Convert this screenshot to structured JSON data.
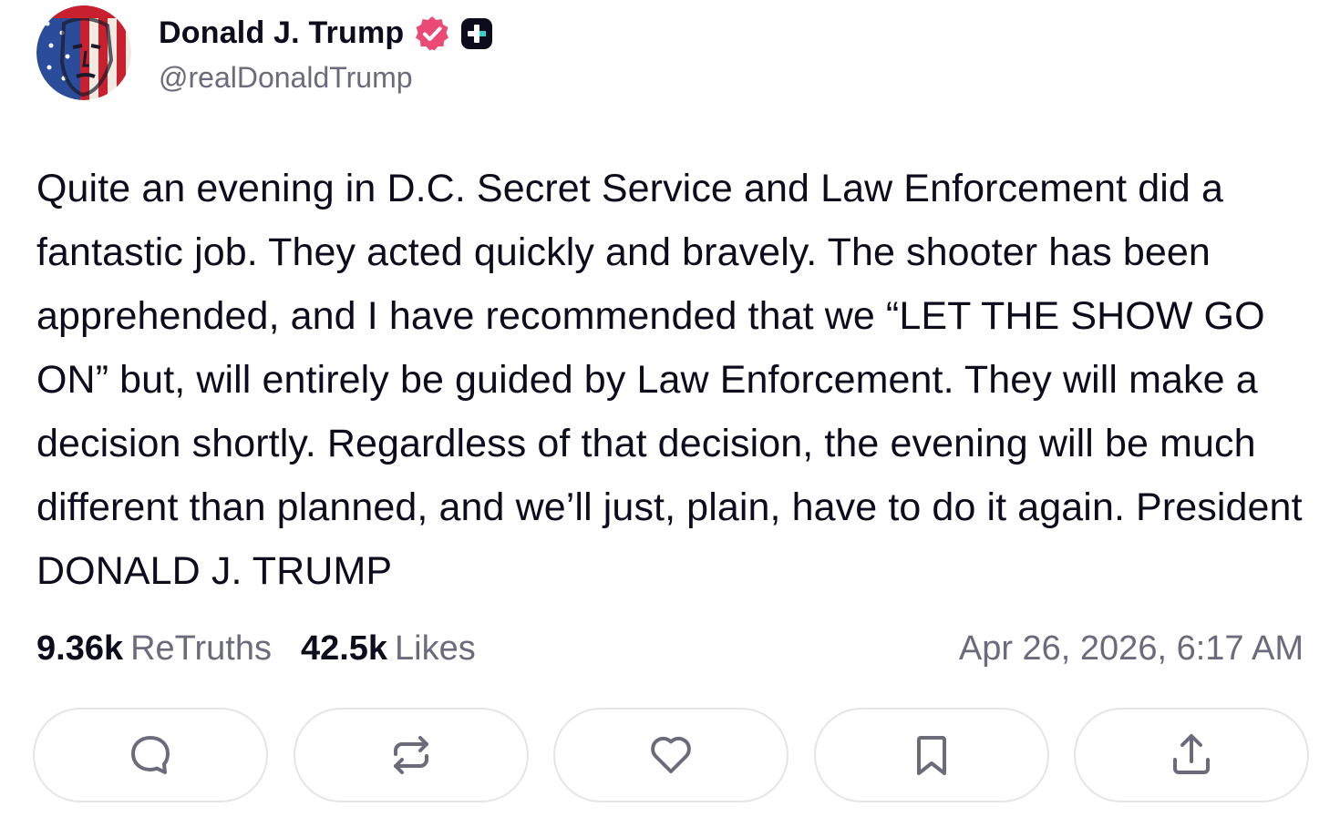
{
  "author": {
    "display_name": "Donald J. Trump",
    "handle": "@realDonaldTrump",
    "avatar_icon": "flag-portrait-avatar",
    "verified_icon": "verified-badge-icon",
    "verified_color": "#eb4a77",
    "plus_badge_icon": "truth-plus-badge-icon"
  },
  "post": {
    "text": "Quite an evening in D.C. Secret Service and Law Enforcement did a fantastic job. They acted quickly and bravely. The shooter has been apprehended, and I have recommended that we “LET THE SHOW GO ON” but, will entirely be guided by Law Enforcement. They will make a decision shortly. Regardless of that decision, the evening will be much different than planned, and we’ll just, plain, have to do it again. President DONALD J. TRUMP"
  },
  "stats": {
    "retruths_count": "9.36k",
    "retruths_label": "ReTruths",
    "likes_count": "42.5k",
    "likes_label": "Likes",
    "timestamp": "Apr 26, 2026, 6:17 AM"
  },
  "actions": [
    {
      "name": "reply",
      "icon": "comment-icon"
    },
    {
      "name": "retruth",
      "icon": "repost-icon"
    },
    {
      "name": "like",
      "icon": "heart-icon"
    },
    {
      "name": "bookmark",
      "icon": "bookmark-icon"
    },
    {
      "name": "share",
      "icon": "share-icon"
    }
  ],
  "colors": {
    "text": "#0d0c1d",
    "muted": "#6b6b7b",
    "border": "#e4e4ea",
    "icon": "#6b6b7b"
  }
}
